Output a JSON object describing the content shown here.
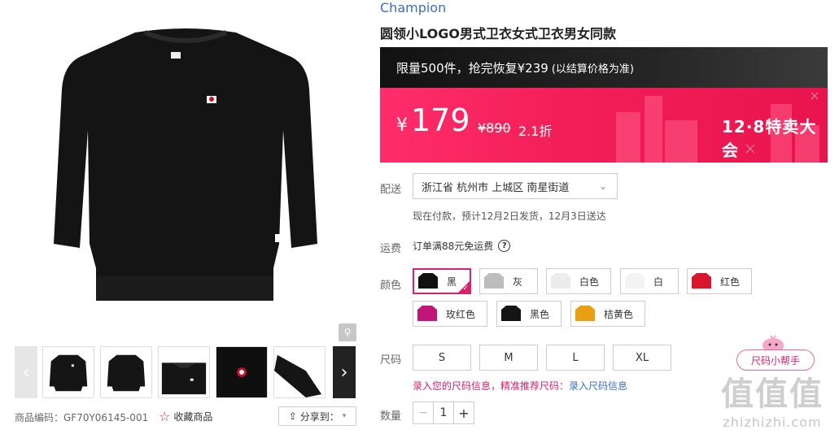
{
  "product": {
    "brand": "Champion",
    "title": "圆领小LOGO男式卫衣女式卫衣男女同款",
    "sku_code": "商品编码：GF70Y06145-001",
    "favorite_label": "收藏商品",
    "share_label": "分享到："
  },
  "promo": {
    "headline": "限量500件，抢完恢复¥239",
    "note": "(以结算价格为准)"
  },
  "price": {
    "currency": "¥",
    "current": "179",
    "original": "¥890",
    "discount": "2.1折",
    "event": "12·8特卖大会"
  },
  "delivery": {
    "label": "配送",
    "address": "浙江省 杭州市 上城区 南星街道",
    "note": "现在付款，预计12月2日发货，12月3日送达"
  },
  "freight": {
    "label": "运费",
    "text": "订单满88元免运费",
    "help": "?"
  },
  "colors": {
    "label": "颜色",
    "options": [
      {
        "name": "黑",
        "swatch": "#111111",
        "selected": true
      },
      {
        "name": "灰",
        "swatch": "#bdbdbd",
        "selected": false
      },
      {
        "name": "白色",
        "swatch": "#f2f2f2",
        "selected": false
      },
      {
        "name": "白",
        "swatch": "#f5f5f5",
        "selected": false
      },
      {
        "name": "红色",
        "swatch": "#d9162c",
        "selected": false
      },
      {
        "name": "玫红色",
        "swatch": "#c0167a",
        "selected": false
      },
      {
        "name": "黑色",
        "swatch": "#141414",
        "selected": false
      },
      {
        "name": "桔黄色",
        "swatch": "#e8a010",
        "selected": false
      }
    ]
  },
  "sizes": {
    "label": "尺码",
    "options": [
      "S",
      "M",
      "L",
      "XL"
    ],
    "info_text": "录入您的尺码信息，精准推荐尺码：",
    "info_link": "录入尺码信息"
  },
  "quantity": {
    "label": "数量",
    "value": "1",
    "minus": "−",
    "plus": "+"
  },
  "helper": {
    "label": "尺码小帮手"
  },
  "watermark": {
    "logo": "值值值",
    "site": "zhizhizhi.com"
  },
  "colors_theme": {
    "accent": "#d6226f",
    "link": "#3a6fc5",
    "promo_bg": "#f21f58"
  }
}
